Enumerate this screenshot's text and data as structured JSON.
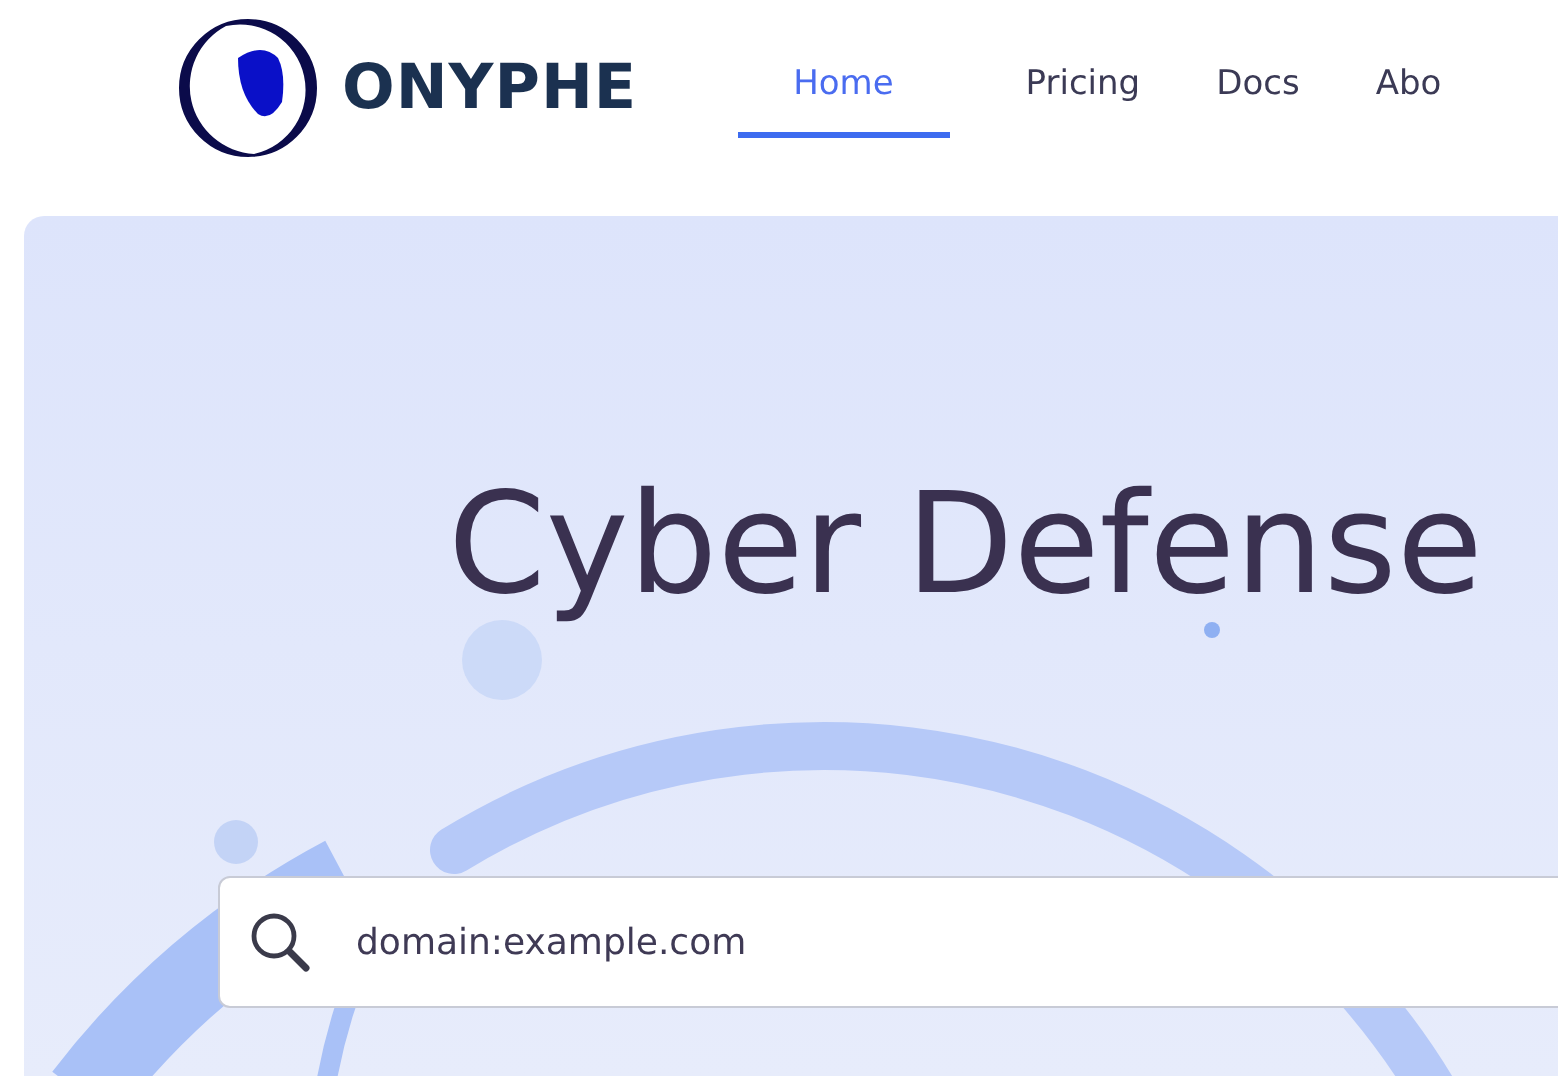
{
  "logo": {
    "text": "ONYPHE"
  },
  "nav": [
    {
      "label": "Home",
      "selected": true
    },
    {
      "label": "Pricing",
      "selected": false
    },
    {
      "label": "Docs",
      "selected": false
    },
    {
      "label": "Abo",
      "selected": false
    }
  ],
  "hero": {
    "title": "Cyber Defense",
    "search": {
      "placeholder": "domain:example.com"
    }
  }
}
